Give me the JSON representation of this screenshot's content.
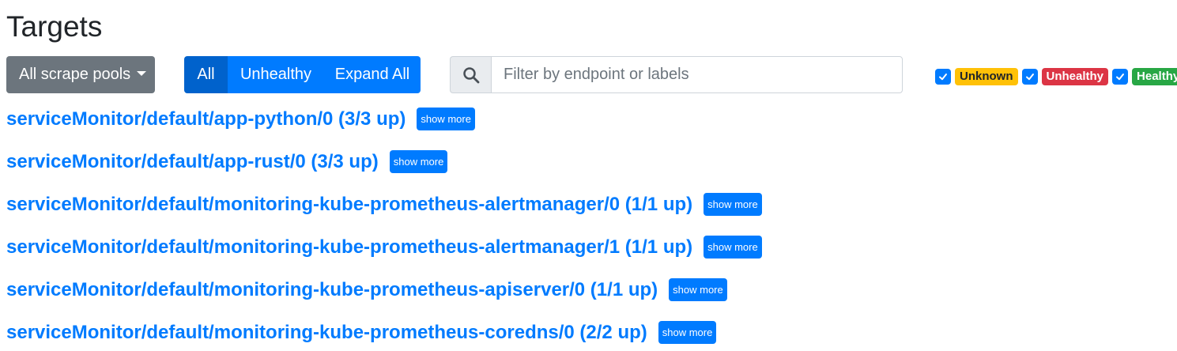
{
  "page": {
    "title": "Targets"
  },
  "toolbar": {
    "scrape_pools_label": "All scrape pools",
    "segments": [
      "All",
      "Unhealthy",
      "Expand All"
    ],
    "search": {
      "placeholder": "Filter by endpoint or labels",
      "value": ""
    },
    "filters": [
      {
        "label": "Unknown",
        "checked": true,
        "color": "#ffc107"
      },
      {
        "label": "Unhealthy",
        "checked": true,
        "color": "#dc3545"
      },
      {
        "label": "Healthy",
        "checked": true,
        "color": "#28a745"
      }
    ]
  },
  "pools": [
    {
      "name": "serviceMonitor/default/app-python/0 (3/3 up)",
      "action": "show more"
    },
    {
      "name": "serviceMonitor/default/app-rust/0 (3/3 up)",
      "action": "show more"
    },
    {
      "name": "serviceMonitor/default/monitoring-kube-prometheus-alertmanager/0 (1/1 up)",
      "action": "show more"
    },
    {
      "name": "serviceMonitor/default/monitoring-kube-prometheus-alertmanager/1 (1/1 up)",
      "action": "show more"
    },
    {
      "name": "serviceMonitor/default/monitoring-kube-prometheus-apiserver/0 (1/1 up)",
      "action": "show more"
    },
    {
      "name": "serviceMonitor/default/monitoring-kube-prometheus-coredns/0 (2/2 up)",
      "action": "show more"
    }
  ],
  "colors": {
    "primary": "#007bff",
    "secondary": "#6c757d"
  }
}
